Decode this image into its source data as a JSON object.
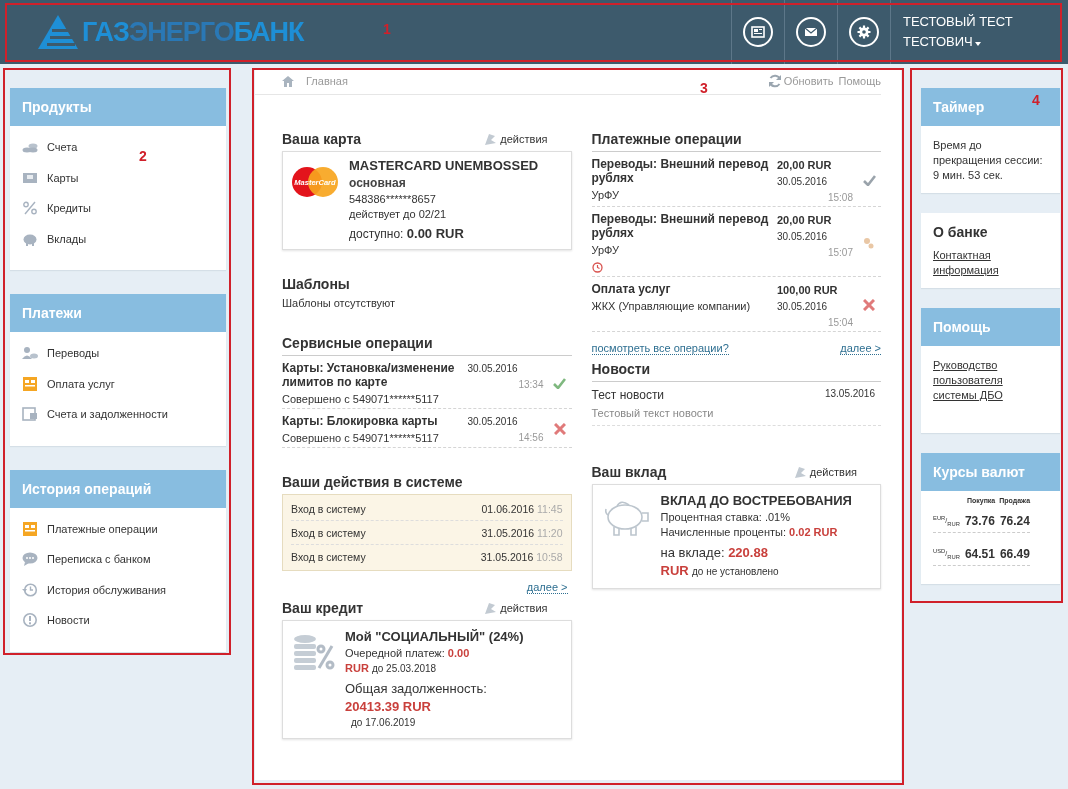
{
  "header": {
    "logo": [
      "ГАЗ",
      "ЭНЕРГО",
      "БАНК"
    ],
    "user": [
      "ТЕСТОВЫЙ ТЕСТ",
      "ТЕСТОВИЧ"
    ]
  },
  "sidebar": [
    {
      "title": "Продукты",
      "items": [
        {
          "label": "Счета"
        },
        {
          "label": "Карты"
        },
        {
          "label": "Кредиты"
        },
        {
          "label": "Вклады"
        }
      ]
    },
    {
      "title": "Платежи",
      "items": [
        {
          "label": "Переводы"
        },
        {
          "label": "Оплата услуг"
        },
        {
          "label": "Счета и задолженности"
        }
      ]
    },
    {
      "title": "История операций",
      "items": [
        {
          "label": "Платежные операции"
        },
        {
          "label": "Переписка с банком"
        },
        {
          "label": "История обслуживания"
        },
        {
          "label": "Новости"
        }
      ]
    }
  ],
  "main": {
    "breadcrumb": "Главная",
    "refresh": "Обновить",
    "help": "Помощь",
    "card": {
      "title": "Ваша карта",
      "actions": "действия",
      "brand": "MasterCard",
      "name": "MASTERCARD UNEMBOSSED",
      "type": "основная",
      "number": "548386******8657",
      "valid": "действует до 02/21",
      "available_label": "доступно:",
      "available": "0.00 RUR"
    },
    "templates": {
      "title": "Шаблоны",
      "empty": "Шаблоны отсутствуют"
    },
    "service_ops": {
      "title": "Сервисные операции",
      "rows": [
        {
          "title": "Карты: Установка/изменение лимитов по карте",
          "sub": "Совершено с 549071******5117",
          "date": "30.05.2016",
          "time": "13:34",
          "kind": "done"
        },
        {
          "title": "Карты: Блокировка карты",
          "sub": "Совершено с 549071******5117",
          "date": "30.05.2016",
          "time": "14:56",
          "kind": "rejected"
        }
      ]
    },
    "activity": {
      "title": "Ваши действия в системе",
      "rows": [
        {
          "action": "Вход в систему",
          "date": "01.06.2016",
          "time": "11:45"
        },
        {
          "action": "Вход в систему",
          "date": "31.05.2016",
          "time": "11:20"
        },
        {
          "action": "Вход в систему",
          "date": "31.05.2016",
          "time": "10:58"
        }
      ],
      "more": "далее >"
    },
    "credit": {
      "title": "Ваш кредит",
      "actions": "действия",
      "name": "Мой \"СОЦИАЛЬНЫЙ\" (24%)",
      "next_label": "Очередной платеж:",
      "next_amount": "0.00",
      "next_currency": "RUR",
      "next_due": "до 25.03.2018",
      "total_label": "Общая задолженность:",
      "total_amount": "20413.39 RUR",
      "total_due": "до 17.06.2019"
    },
    "payment_ops": {
      "title": "Платежные операции",
      "rows": [
        {
          "title": "Переводы: Внешний перевод рублях",
          "sub": "УрФУ",
          "amount": "20,00 RUR",
          "date": "30.05.2016",
          "time": "15:08",
          "kind": "done"
        },
        {
          "title": "Переводы: Внешний перевод рублях",
          "sub": "УрФУ",
          "amount": "20,00 RUR",
          "date": "30.05.2016",
          "time": "15:07",
          "kind": "pending"
        },
        {
          "title": "Оплата услуг",
          "sub": "ЖКХ (Управляющие компании)",
          "amount": "100,00 RUR",
          "date": "30.05.2016",
          "time": "15:04",
          "kind": "rejected"
        }
      ],
      "all_link": "посмотреть все операции?",
      "more": "далее >"
    },
    "news": {
      "title": "Новости",
      "items": [
        {
          "title": "Тест новости",
          "date": "13.05.2016",
          "text": "Тестовый текст новости"
        }
      ]
    },
    "deposit": {
      "title": "Ваш вклад",
      "actions": "действия",
      "name": "ВКЛАД ДО ВОСТРЕБОВАНИЯ",
      "rate": "Процентная ставка: .01%",
      "accrued_label": "Начисленные проценты:",
      "accrued": "0.02 RUR",
      "balance_label": "на вкладе:",
      "balance": "220.88",
      "currency": "RUR",
      "due": "до не установлено"
    }
  },
  "right": {
    "timer": {
      "title": "Таймер",
      "text": "Время до прекращения сессии:",
      "remaining": "9 мин. 53 сек."
    },
    "about": {
      "title": "О банке",
      "link": "Контактная информация"
    },
    "help": {
      "title": "Помощь",
      "link": "Руководство пользователя системы ДБО"
    },
    "rates": {
      "title": "Курсы валют",
      "columns": [
        "Покупка",
        "Продажа"
      ],
      "rows": [
        {
          "pair": "$^{EUR}$/$_{RUR}$",
          "buy": "73.76",
          "sell": "76.24"
        },
        {
          "pair": "$^{USD}$/$_{RUR}$",
          "buy": "64.51",
          "sell": "66.49"
        }
      ]
    }
  },
  "annotations": [
    {
      "label": "1"
    },
    {
      "label": "2"
    },
    {
      "label": "3"
    },
    {
      "label": "4"
    }
  ]
}
